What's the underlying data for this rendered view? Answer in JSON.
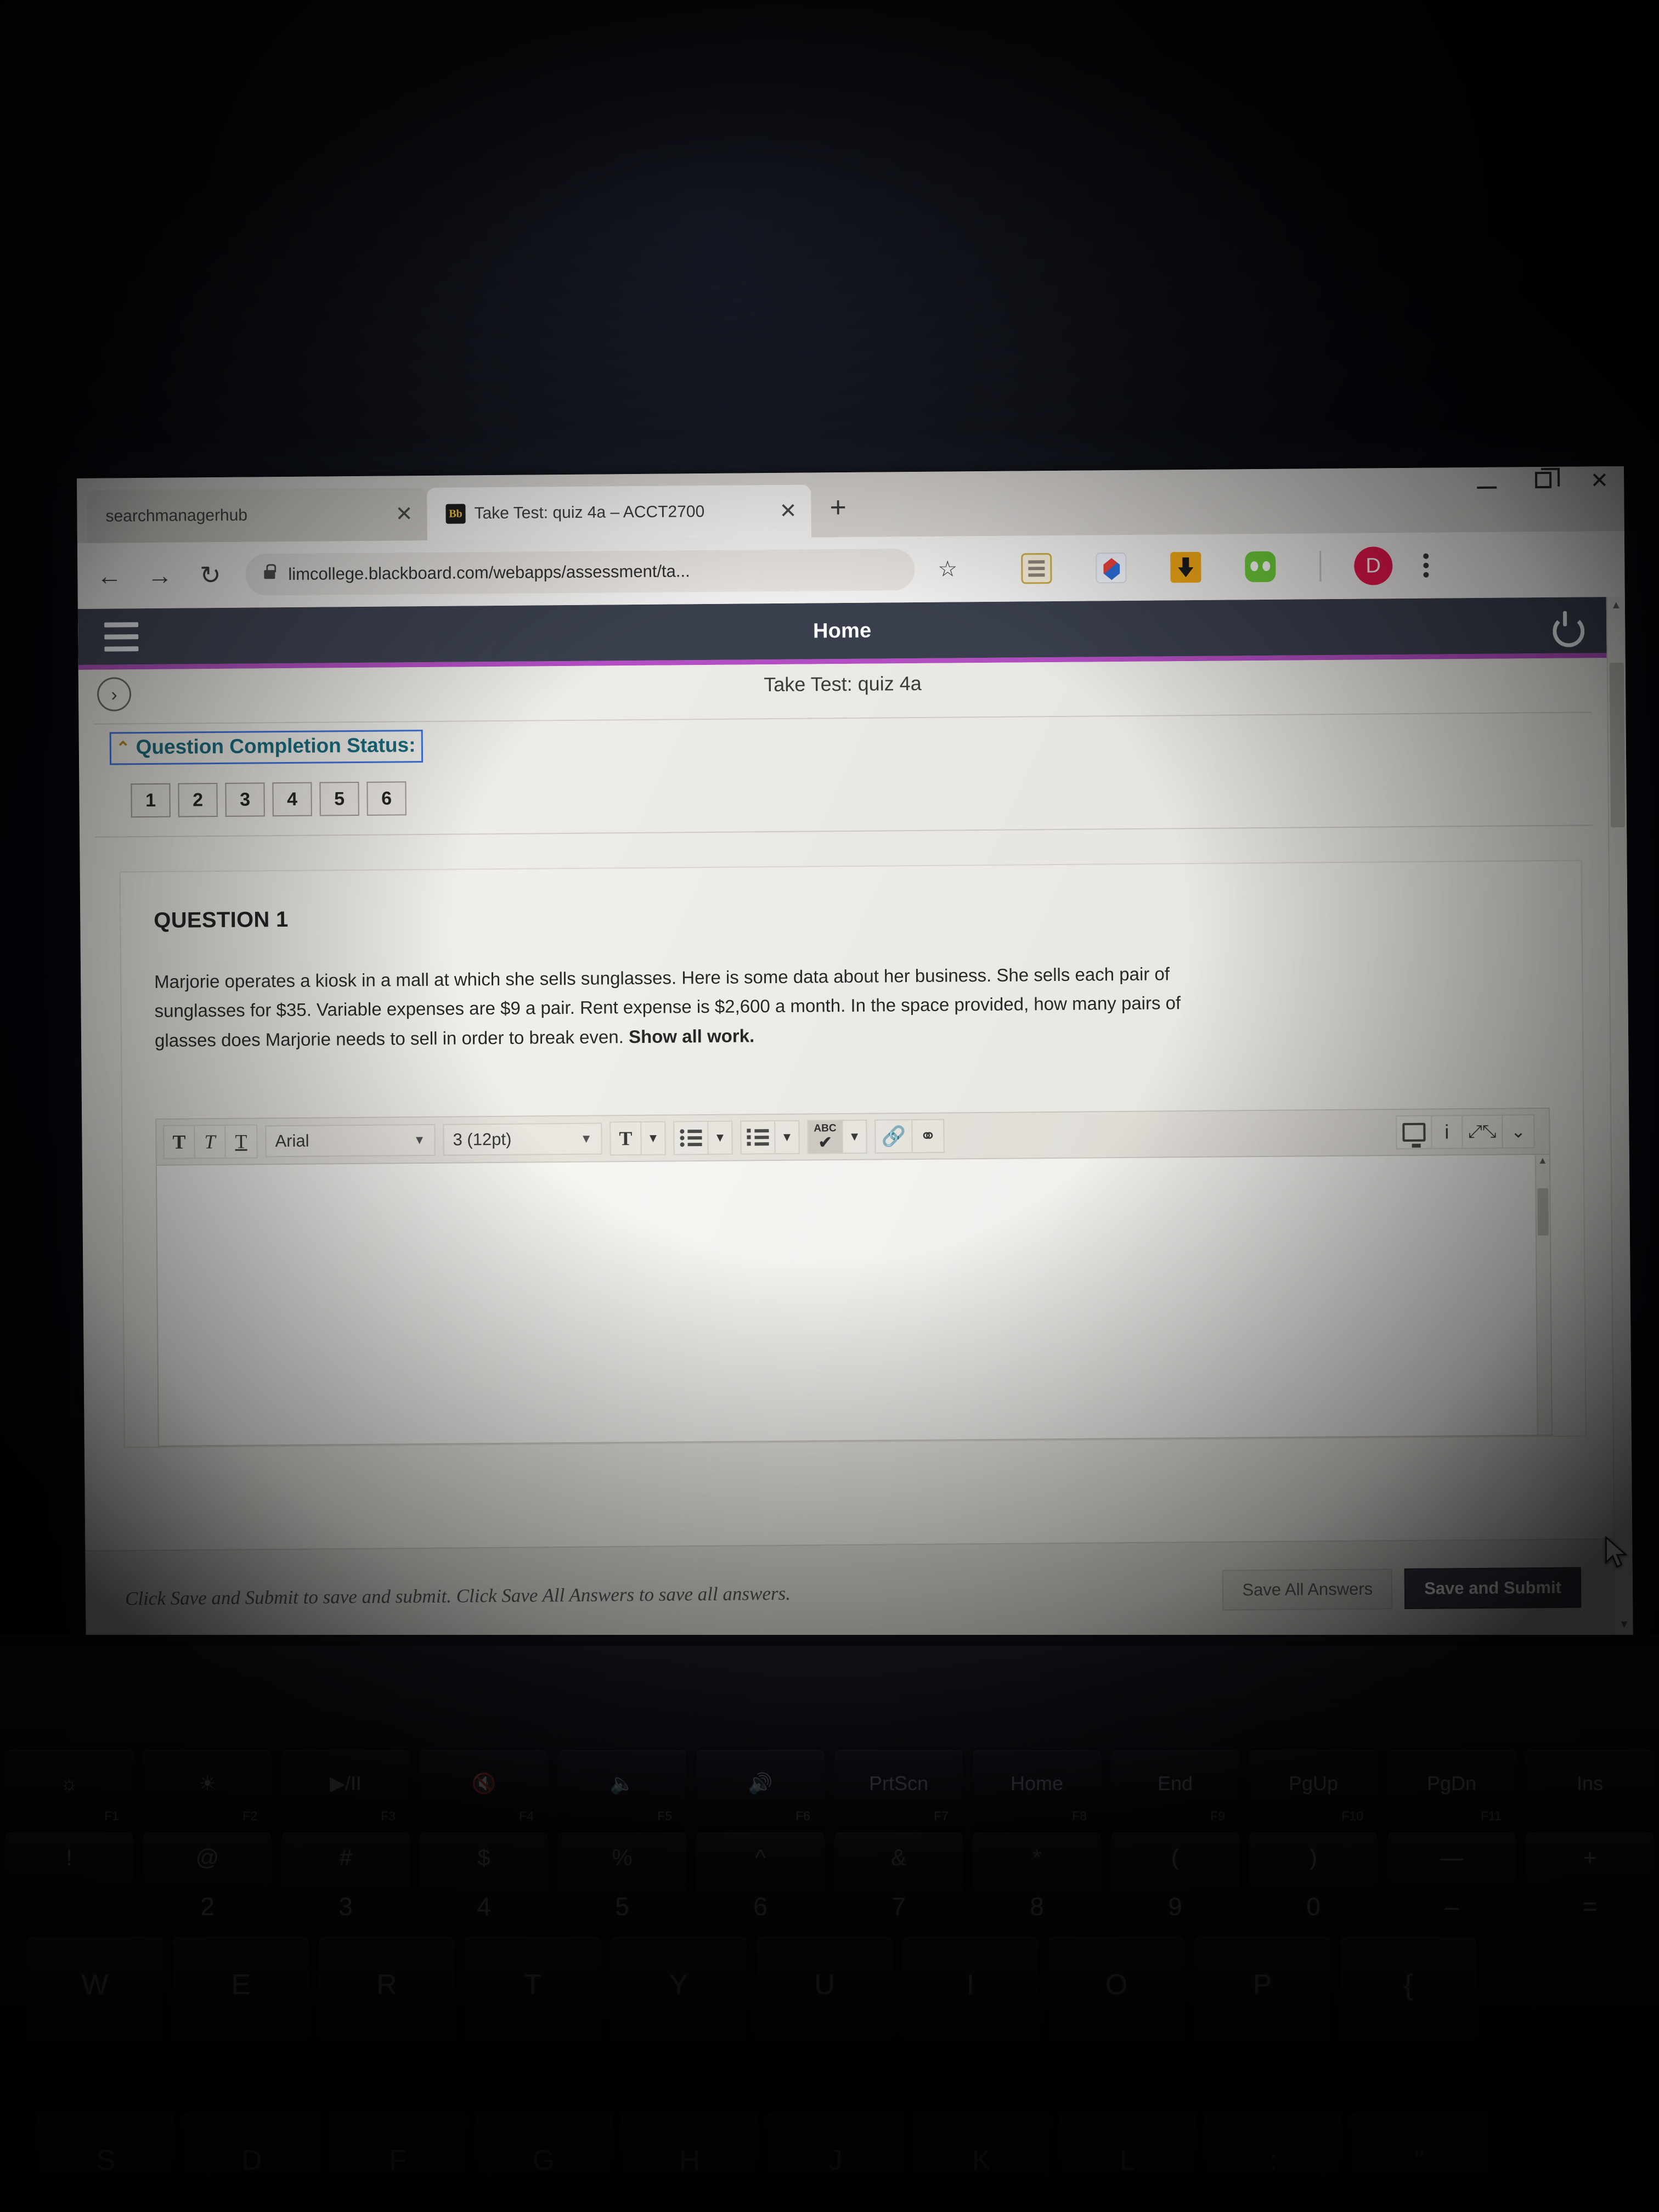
{
  "browser": {
    "tabs": [
      {
        "title": "searchmanagerhub",
        "favicon": "none",
        "active": false,
        "close_label": "✕"
      },
      {
        "title": "Take Test: quiz 4a – ACCT2700",
        "favicon": "Bb",
        "active": true,
        "close_label": "✕"
      }
    ],
    "new_tab_label": "+",
    "window_controls": {
      "minimize": "minimize-icon",
      "maximize": "restore-icon",
      "close": "✕"
    },
    "nav": {
      "back": "←",
      "forward": "→",
      "reload": "↻"
    },
    "url": "limcollege.blackboard.com/webapps/assessment/ta...",
    "bookmark_icon": "☆",
    "extensions": [
      "note-extension-icon",
      "diamond-extension-icon",
      "download-extension-icon",
      "green-extension-icon"
    ],
    "profile_initial": "D",
    "menu_icon": "kebab-menu-icon"
  },
  "blackboard": {
    "top_title": "Home",
    "menu_icon": "hamburger-icon",
    "logout_icon": "power-icon",
    "breadcrumb_toggle": "›",
    "test_title": "Take Test: quiz 4a",
    "status": {
      "caret": "⌃",
      "label": "Question Completion Status:",
      "questions": [
        "1",
        "2",
        "3",
        "4",
        "5",
        "6"
      ]
    },
    "question": {
      "heading": "QUESTION 1",
      "body": "Marjorie operates a kiosk in a mall at which she sells sunglasses.   Here is some data about her business.  She sells each pair of sunglasses for $35.  Variable expenses are $9 a pair.  Rent expense is $2,600 a month.  In the space provided, how many pairs of glasses does Marjorie needs to sell in order to break even.  ",
      "body_bold": "Show all work."
    },
    "editor": {
      "bold": "T",
      "italic": "T",
      "underline": "T",
      "font_family": "Arial",
      "font_size": "3 (12pt)",
      "text_color_icon": "text-color-icon",
      "bullet_list_icon": "bullet-list-icon",
      "numbered_list_icon": "numbered-list-icon",
      "spellcheck_label": "ABC",
      "spellcheck_tick": "✔",
      "link_icon": "link-icon",
      "unlink_icon": "unlink-icon",
      "preview_icon": "preview-monitor-icon",
      "info_icon": "i",
      "fullscreen_icon": "fullscreen-icon",
      "collapse_icon": "»",
      "dropdown_caret": "▼",
      "content": ""
    },
    "footer": {
      "note": "Click Save and Submit to save and submit. Click Save All Answers to save all answers.",
      "save_all_label": "Save All Answers",
      "save_submit_label": "Save and Submit"
    },
    "scroll": {
      "up": "▲",
      "down": "▼"
    }
  },
  "keyboard": {
    "function_row": [
      {
        "top": "brightness-down-icon",
        "fn": "F1"
      },
      {
        "top": "brightness-up-icon",
        "fn": "F2"
      },
      {
        "top": "▶/II",
        "fn": "F3"
      },
      {
        "top": "mute-icon",
        "fn": "F4"
      },
      {
        "top": "volume-down-icon",
        "fn": "F5"
      },
      {
        "top": "volume-up-icon",
        "fn": "F6"
      },
      {
        "top": "PrtScn",
        "fn": "F7"
      },
      {
        "top": "Home",
        "fn": "F8"
      },
      {
        "top": "End",
        "fn": "F9"
      },
      {
        "top": "PgUp",
        "fn": "F10"
      },
      {
        "top": "PgDn",
        "fn": "F11"
      },
      {
        "top": "Ins",
        "fn": ""
      }
    ],
    "number_row": [
      {
        "sym": "!",
        "num": ""
      },
      {
        "sym": "@",
        "num": "2"
      },
      {
        "sym": "#",
        "num": "3"
      },
      {
        "sym": "$",
        "num": "4"
      },
      {
        "sym": "%",
        "num": "5"
      },
      {
        "sym": "^",
        "num": "6"
      },
      {
        "sym": "&",
        "num": "7"
      },
      {
        "sym": "*",
        "num": "8"
      },
      {
        "sym": "(",
        "num": "9"
      },
      {
        "sym": ")",
        "num": "0"
      },
      {
        "sym": "—",
        "num": "–"
      },
      {
        "sym": "+",
        "num": "="
      }
    ],
    "letter_row_1": [
      "W",
      "E",
      "R",
      "T",
      "Y",
      "U",
      "I",
      "O",
      "P",
      "{",
      "["
    ],
    "letter_row_2": [
      "S",
      "D",
      "F",
      "G",
      "H",
      "J",
      "K",
      "L",
      ":",
      "\""
    ]
  },
  "colors": {
    "bb_header": "#3c4150",
    "bb_accent": "#b44fc4",
    "primary_button": "#3b3f4c",
    "profile_badge": "#e8194f",
    "status_link": "#16687b"
  }
}
